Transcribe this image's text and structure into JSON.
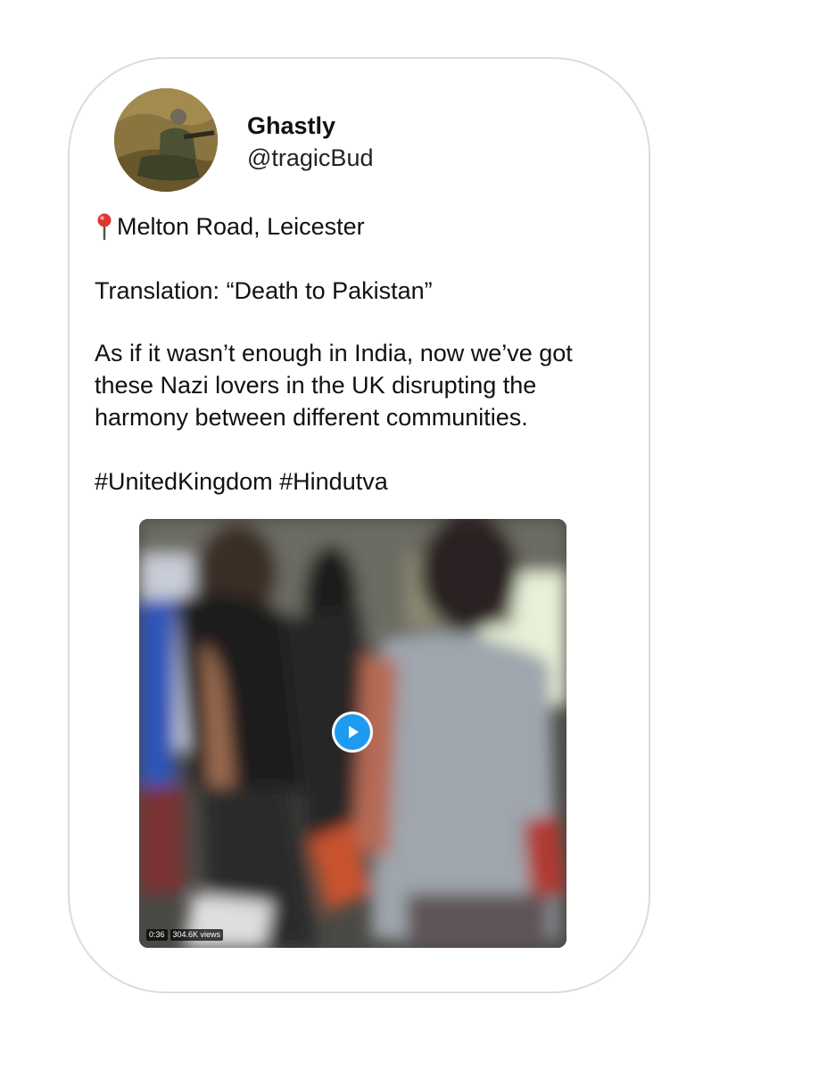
{
  "tweet": {
    "author": {
      "display_name": "Ghastly",
      "handle": "@tragicBud"
    },
    "location": "Melton Road, Leicester",
    "translation": "Translation: “Death to Pakistan”",
    "paragraph": [
      "As if it wasn’t enough in India, now we’ve got",
      "these Nazi lovers in the UK disrupting the",
      "harmony between different communities."
    ],
    "hashtags": [
      "#UnitedKingdom",
      "#Hindutva"
    ],
    "video": {
      "duration": "0:36",
      "views": "304.6K views"
    }
  },
  "colors": {
    "card_border": "#dcdcdc",
    "play_accent": "#1d9bf0",
    "pin": "#e0362f"
  }
}
